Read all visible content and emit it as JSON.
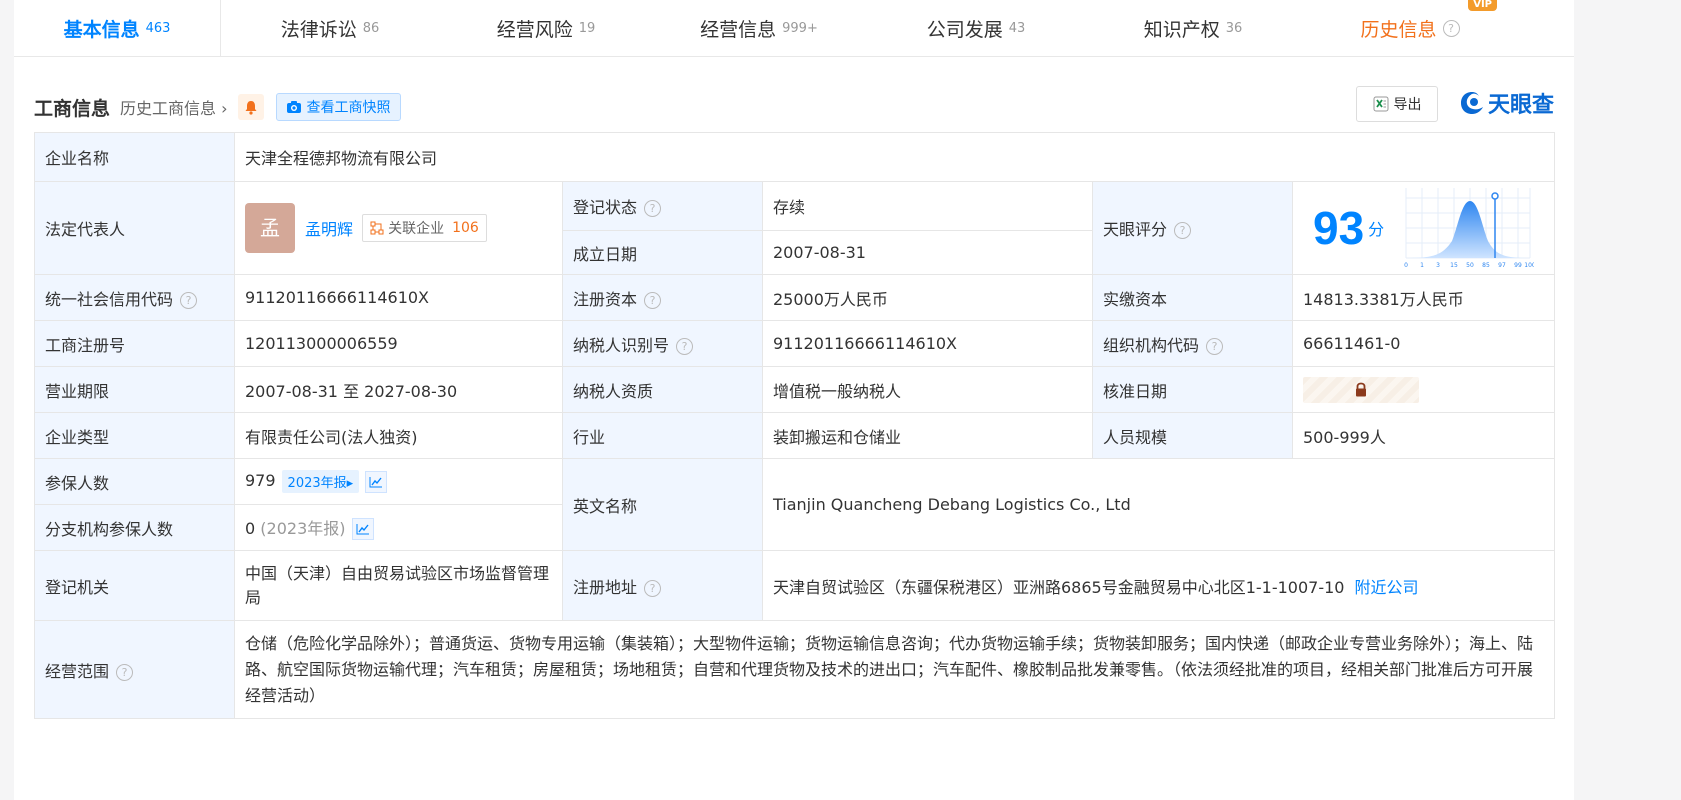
{
  "tabs": [
    {
      "label": "基本信息",
      "count": "463"
    },
    {
      "label": "法律诉讼",
      "count": "86"
    },
    {
      "label": "经营风险",
      "count": "19"
    },
    {
      "label": "经营信息",
      "count": "999+"
    },
    {
      "label": "公司发展",
      "count": "43"
    },
    {
      "label": "知识产权",
      "count": "36"
    },
    {
      "label": "历史信息",
      "count": ""
    }
  ],
  "vip_badge": "VIP",
  "section": {
    "title": "工商信息",
    "history_link": "历史工商信息",
    "snapshot_button": "查看工商快照",
    "export_button": "导出",
    "logo_text": "天眼查"
  },
  "fields": {
    "company_name_label": "企业名称",
    "company_name": "天津全程德邦物流有限公司",
    "legal_rep_label": "法定代表人",
    "legal_rep_avatar": "孟",
    "legal_rep_name": "孟明辉",
    "assoc_label": "关联企业",
    "assoc_count": "106",
    "reg_status_label": "登记状态",
    "reg_status": "存续",
    "found_date_label": "成立日期",
    "found_date": "2007-08-31",
    "score_label": "天眼评分",
    "score": "93",
    "score_unit": "分",
    "credit_code_label": "统一社会信用代码",
    "credit_code": "91120116666114610X",
    "reg_capital_label": "注册资本",
    "reg_capital": "25000万人民币",
    "paid_capital_label": "实缴资本",
    "paid_capital": "14813.3381万人民币",
    "biz_reg_no_label": "工商注册号",
    "biz_reg_no": "120113000006559",
    "taxpayer_id_label": "纳税人识别号",
    "taxpayer_id": "91120116666114610X",
    "org_code_label": "组织机构代码",
    "org_code": "66611461-0",
    "biz_term_label": "营业期限",
    "biz_term": "2007-08-31 至 2027-08-30",
    "tax_qual_label": "纳税人资质",
    "tax_qual": "增值税一般纳税人",
    "approve_date_label": "核准日期",
    "company_type_label": "企业类型",
    "company_type": "有限责任公司(法人独资)",
    "industry_label": "行业",
    "industry": "装卸搬运和仓储业",
    "staff_size_label": "人员规模",
    "staff_size": "500-999人",
    "insured_label": "参保人数",
    "insured": "979",
    "insured_year": "2023年报",
    "english_name_label": "英文名称",
    "english_name": "Tianjin Quancheng Debang Logistics Co., Ltd",
    "branch_insured_label": "分支机构参保人数",
    "branch_insured": "0",
    "branch_insured_year": "(2023年报)",
    "reg_authority_label": "登记机关",
    "reg_authority": "中国（天津）自由贸易试验区市场监督管理局",
    "reg_address_label": "注册地址",
    "reg_address": "天津自贸试验区（东疆保税港区）亚洲路6865号金融贸易中心北区1-1-1007-10",
    "nearby_link": "附近公司",
    "scope_label": "经营范围",
    "scope": "仓储（危险化学品除外）；普通货运、货物专用运输（集装箱）；大型物件运输；货物运输信息咨询；代办货物运输手续；货物装卸服务；国内快递（邮政企业专营业务除外）；海上、陆路、航空国际货物运输代理；汽车租赁；房屋租赁；场地租赁；自营和代理货物及技术的进出口；汽车配件、橡胶制品批发兼零售。（依法须经批准的项目，经相关部门批准后方可开展经营活动）"
  },
  "score_chart": {
    "x_ticks": [
      "0",
      "1",
      "3",
      "15",
      "50",
      "85",
      "97",
      "99",
      "100"
    ],
    "marker_value": 93
  },
  "colors": {
    "accent": "#0084ff",
    "history": "#f2711c",
    "label_bg": "#f0f6ff",
    "status": "#2bb24c"
  }
}
